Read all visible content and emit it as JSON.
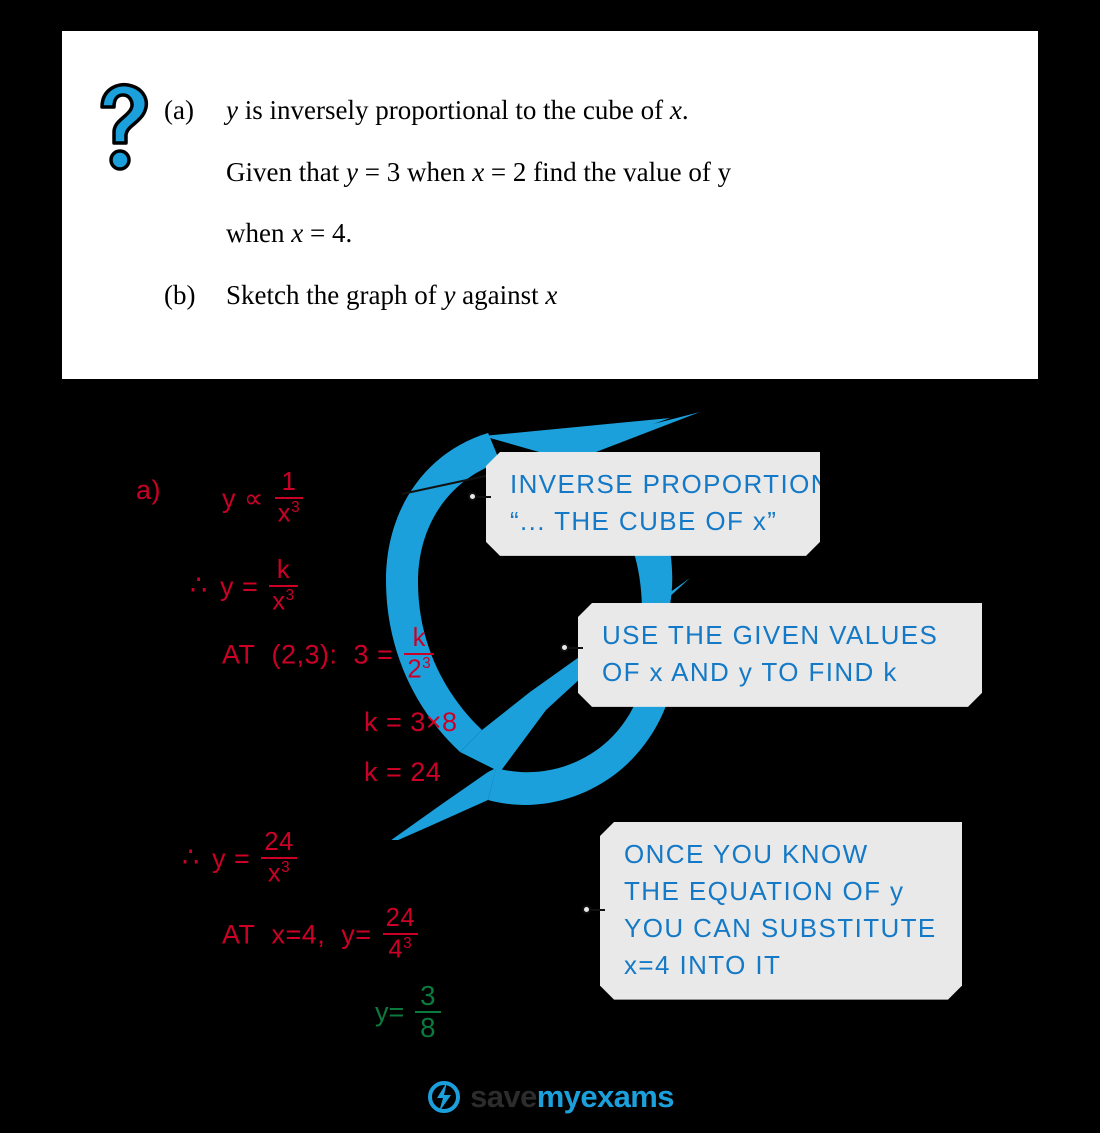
{
  "colors": {
    "brand_blue": "#1BA0DC",
    "callout_text_blue": "#1479C6",
    "callout_bg": "#E9E9E9",
    "working_red": "#CC0026",
    "answer_green": "#0B7A3D",
    "card_bg": "#FFFFFF",
    "page_bg": "#000000"
  },
  "question": {
    "icon": "question-mark-icon",
    "parts": [
      {
        "label": "(a)",
        "lines": [
          "y is inversely proportional to the cube of x.",
          "Given that y = 3 when x = 2 find the value of y",
          "when x = 4."
        ]
      },
      {
        "label": "(b)",
        "lines": [
          "Sketch the graph of y against x"
        ]
      }
    ]
  },
  "working": {
    "part_label": "a)",
    "steps": [
      {
        "id": "proportionality",
        "text": "y ∝ 1/x³"
      },
      {
        "id": "equation-with-k",
        "text": "∴ y = k/x³"
      },
      {
        "id": "substitute-point",
        "text": "AT (2,3):  3 = k/2³"
      },
      {
        "id": "k-product",
        "text": "k = 3×8"
      },
      {
        "id": "k-value",
        "text": "k = 24"
      },
      {
        "id": "final-equation",
        "text": "∴ y = 24/x³"
      },
      {
        "id": "substitute-x4",
        "text": "AT  x=4,  y = 24/4³"
      },
      {
        "id": "answer",
        "text": "y = 3/8"
      }
    ],
    "tokens": {
      "part_a": "a)",
      "y": "y",
      "prop_symbol": "∝",
      "one": "1",
      "x_cubed": "x",
      "cube_exp": "3",
      "therefore": "∴",
      "equals": "=",
      "k": "k",
      "at": "AT",
      "point_23": "(2,3):",
      "three": "3",
      "two": "2",
      "k_eq_3x8": "k = 3×8",
      "k_eq_24": "k = 24",
      "twentyfour": "24",
      "at_x4": "AT  x=4,",
      "four": "4",
      "eight": "8"
    }
  },
  "callouts": [
    {
      "id": "callout-inverse-proportion",
      "lines": [
        "INVERSE   PROPORTION",
        "“... THE  CUBE  OF  x”"
      ]
    },
    {
      "id": "callout-use-given-values",
      "lines": [
        "USE  THE  GIVEN  VALUES",
        "OF  x  AND  y  TO  FIND  k"
      ]
    },
    {
      "id": "callout-substitute",
      "lines": [
        "ONCE  YOU  KNOW",
        "THE  EQUATION  OF  y",
        "YOU  CAN  SUBSTITUTE",
        "x=4  INTO  IT"
      ]
    }
  ],
  "footer": {
    "logo_icon": "save-my-exams-logo-icon",
    "word1": "save",
    "word2": "my",
    "word3": "exams"
  }
}
